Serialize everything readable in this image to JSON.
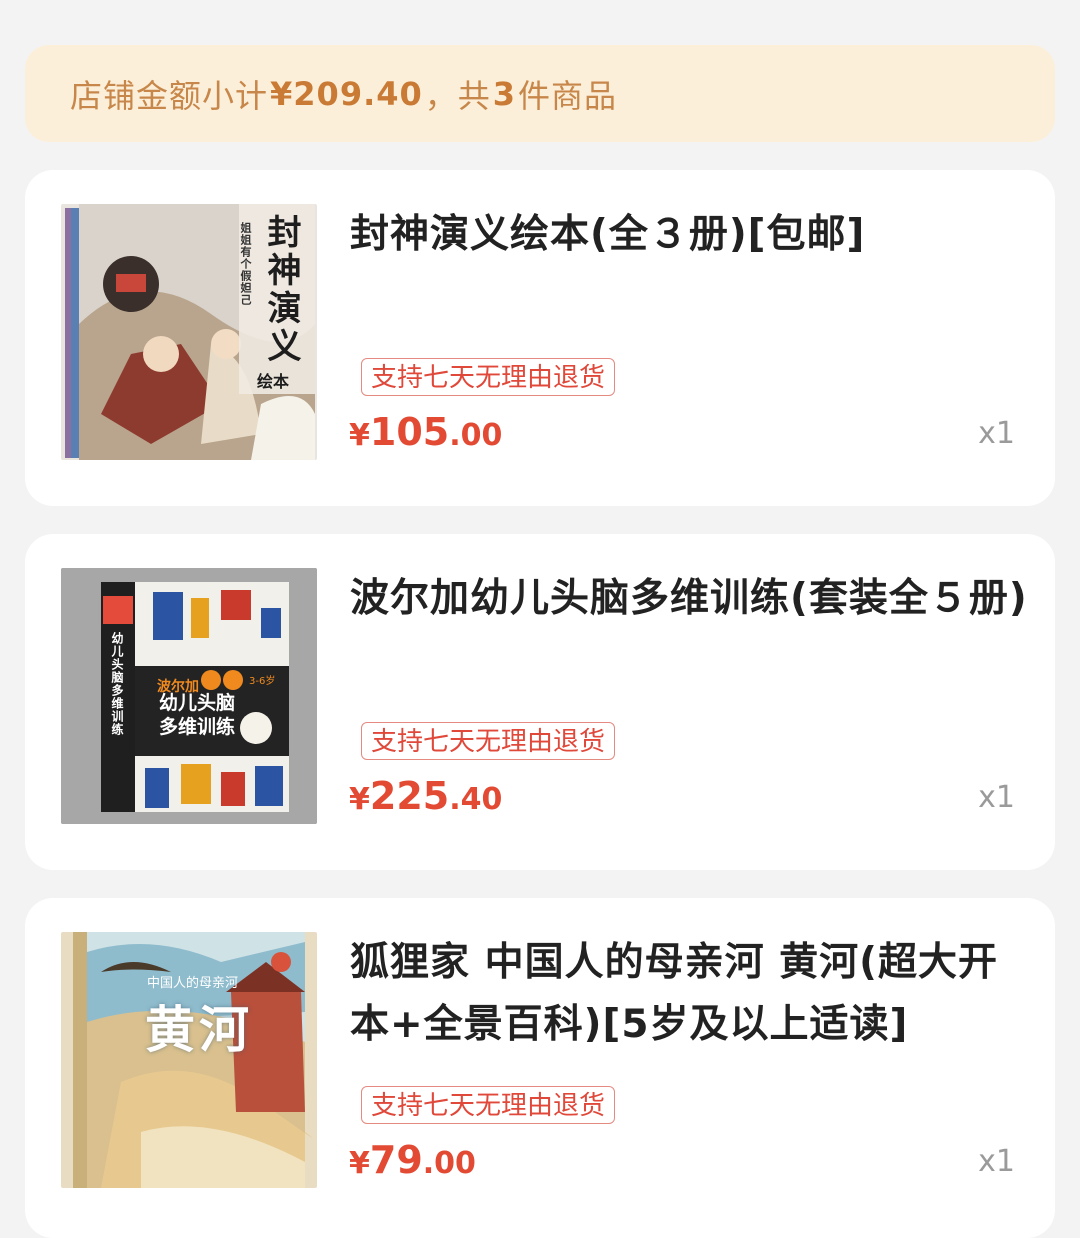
{
  "summary": {
    "prefix": "店铺金额小计",
    "amount": "¥209.40",
    "sep": "，共",
    "count": "3",
    "suffix": "件商品"
  },
  "items": [
    {
      "title": "封神演义绘本(全３册)[包邮]",
      "tag": "支持七天无理由退货",
      "price_yen": "¥",
      "price_int": "105",
      "price_dec": ".00",
      "qty": "x1",
      "cover": {
        "title": "封神演义",
        "subtitle": "绘本",
        "side": "姐姐有个假妲己"
      }
    },
    {
      "title": "波尔加幼儿头脑多维训练(套装全５册)",
      "tag": "支持七天无理由退货",
      "price_yen": "¥",
      "price_int": "225",
      "price_dec": ".40",
      "qty": "x1",
      "cover": {
        "brand": "波尔加",
        "line1": "幼儿头脑",
        "line2": "多维训练",
        "spine": "幼儿头脑多维训练",
        "age": "3-6岁"
      }
    },
    {
      "title": "狐狸家 中国人的母亲河 黄河(超大开本+全景百科)[5岁及以上适读]",
      "tag": "支持七天无理由退货",
      "price_yen": "¥",
      "price_int": "79",
      "price_dec": ".00",
      "qty": "x1",
      "cover": {
        "small": "中国人的母亲河",
        "title": "黄河"
      }
    }
  ],
  "colors": {
    "price": "#e24a33",
    "tag": "#e0483a",
    "summary_bg": "#fcefd9",
    "summary_text": "#c8874a"
  }
}
